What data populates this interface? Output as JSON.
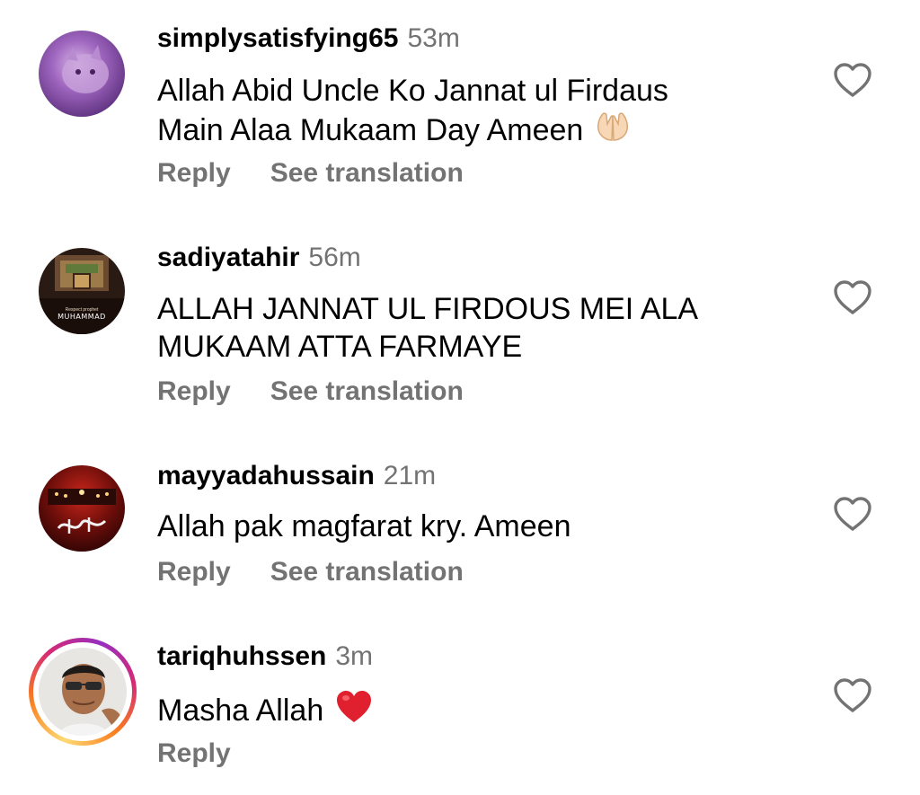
{
  "comments": [
    {
      "username": "simplysatisfying65",
      "time": "53m",
      "text_line1": "Allah Abid Uncle Ko Jannat ul Firdaus",
      "text_line2": "Main Alaa Mukaam Day Ameen",
      "emoji": "praying-hands-icon",
      "reply": "Reply",
      "translate": "See translation"
    },
    {
      "username": "sadiyatahir",
      "time": "56m",
      "text_line1": "ALLAH JANNAT UL FIRDOUS MEI ALA",
      "text_line2": "MUKAAM ATTA FARMAYE",
      "avatar_text": "MUHAMMAD",
      "reply": "Reply",
      "translate": "See translation"
    },
    {
      "username": "mayyadahussain",
      "time": "21m",
      "text_line1": "Allah pak magfarat kry. Ameen",
      "reply": "Reply",
      "translate": "See translation"
    },
    {
      "username": "tariqhuhssen",
      "time": "3m",
      "text_line1": "Masha Allah",
      "emoji": "red-heart-icon",
      "reply": "Reply"
    }
  ],
  "colors": {
    "secondary_text": "#737373",
    "heart_emoji": "#e0202e",
    "story_ring": [
      "#feda75",
      "#fa7e1e",
      "#d62976",
      "#962fbf"
    ]
  },
  "icons": {
    "like": "heart-outline-icon"
  }
}
